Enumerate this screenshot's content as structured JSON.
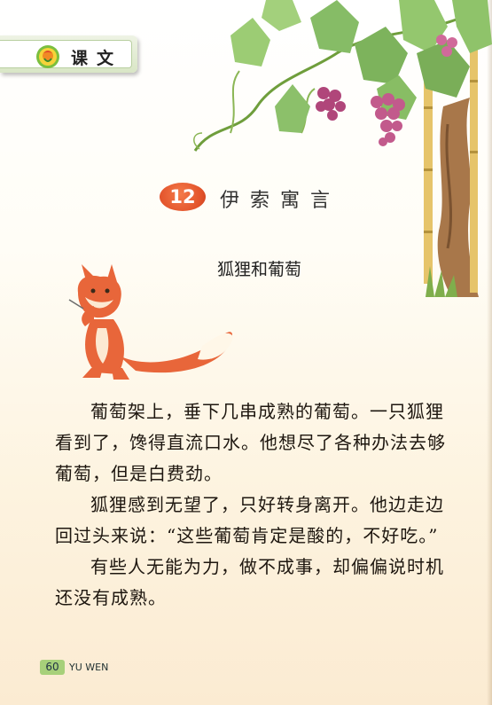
{
  "header": {
    "section_label": "课文"
  },
  "lesson": {
    "number": "12",
    "title": "伊索寓言"
  },
  "story": {
    "title": "狐狸和葡萄",
    "paragraphs": [
      "葡萄架上，垂下几串成熟的葡萄。一只狐狸看到了，馋得直流口水。他想尽了各种办法去够葡萄，但是白费劲。",
      "狐狸感到无望了，只好转身离开。他边走边回过头来说：“这些葡萄肯定是酸的，不好吃。”",
      "有些人无能为力，做不成事，却偏偏说时机还没有成熟。"
    ]
  },
  "footer": {
    "page_number": "60",
    "label": "YU WEN"
  },
  "icons": {
    "header_icon": "flower-icon",
    "illustration_top": "grapevine-illustration",
    "illustration_left": "fox-illustration"
  },
  "colors": {
    "badge": "#e2522a",
    "tab_green": "#a7d07a",
    "grape": "#b0467a",
    "fox": "#e8663a"
  }
}
